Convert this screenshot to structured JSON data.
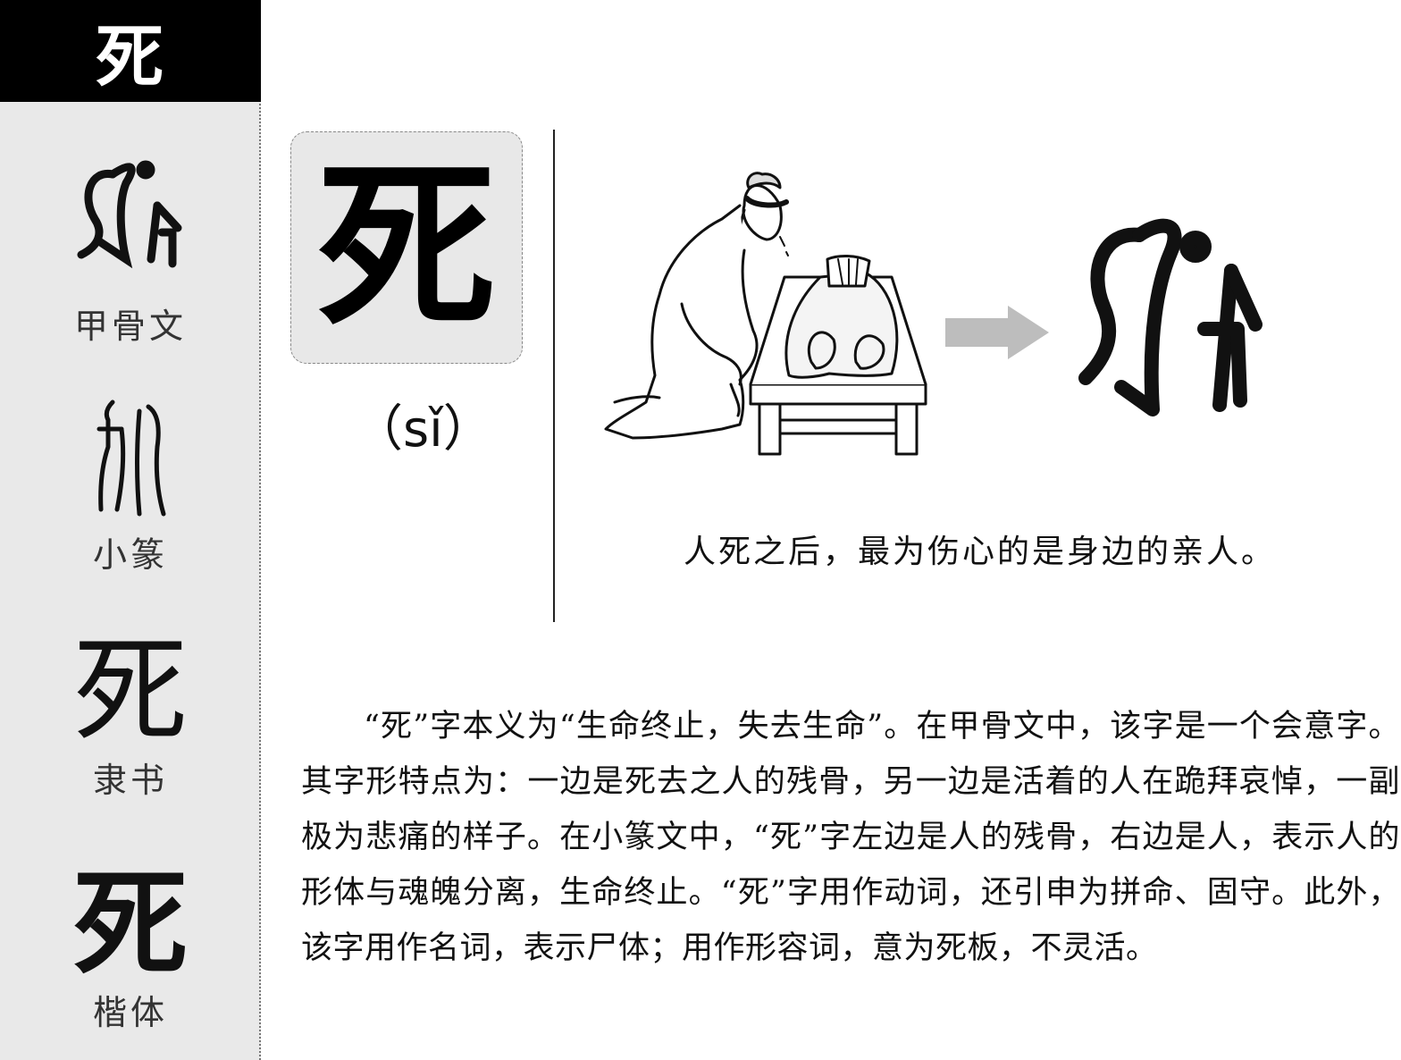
{
  "sidebar": {
    "title": "死",
    "forms": [
      {
        "label": "甲骨文",
        "glyph": ""
      },
      {
        "label": "小篆",
        "glyph": ""
      },
      {
        "label": "隶书",
        "glyph": "死"
      },
      {
        "label": "楷体",
        "glyph": "死"
      }
    ]
  },
  "main": {
    "character": "死",
    "pinyin": "（sǐ）",
    "caption": "人死之后，最为伤心的是身边的亲人。",
    "description": "“死”字本义为“生命终止，失去生命”。在甲骨文中，该字是一个会意字。其字形特点为：一边是死去之人的残骨，另一边是活着的人在跪拜哀悼，一副极为悲痛的样子。在小篆文中，“死”字左边是人的残骨，右边是人，表示人的形体与魂魄分离，生命终止。“死”字用作动词，还引申为拼命、固守。此外，该字用作名词，表示尸体；用作形容词，意为死板，不灵活。"
  },
  "colors": {
    "sidebar_bg": "#e9e9e9",
    "header_bg": "#000000",
    "tile_bg": "#e8e8e8",
    "arrow": "#bdbdbd"
  }
}
